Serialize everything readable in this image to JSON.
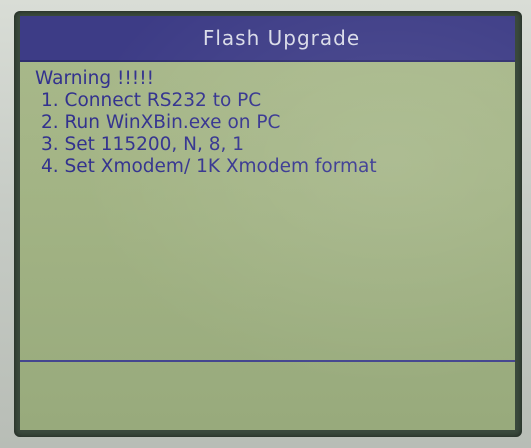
{
  "screen": {
    "title": "Flash Upgrade"
  },
  "message": {
    "heading": "Warning !!!!!",
    "steps": [
      "1. Connect RS232 to PC",
      "2. Run WinXBin.exe on PC",
      "3. Set 115200, N, 8, 1",
      "4. Set Xmodem/ 1K Xmodem format"
    ]
  },
  "colors": {
    "title_bar": "#3d3c86",
    "lcd_background": "#a3b485",
    "text": "#32318e"
  }
}
